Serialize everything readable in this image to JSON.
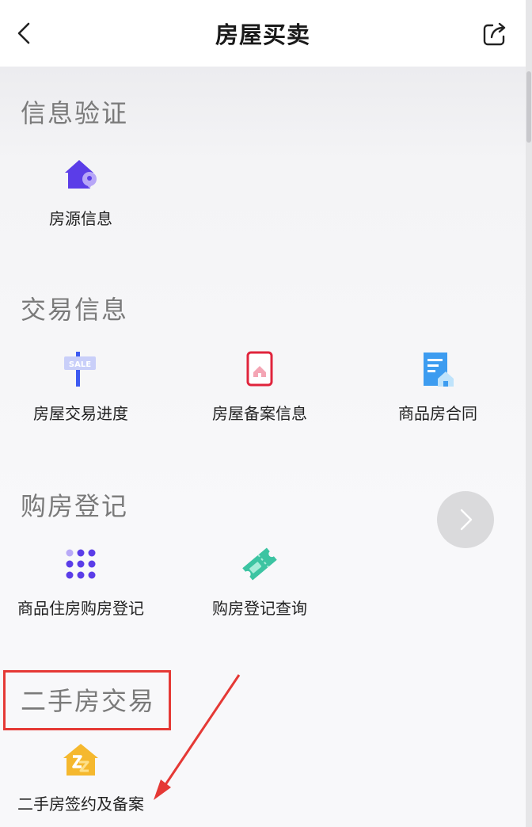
{
  "header": {
    "title": "房屋买卖"
  },
  "sections": [
    {
      "title": "信息验证",
      "items": [
        {
          "label": "房源信息",
          "icon": "house-location-icon"
        }
      ]
    },
    {
      "title": "交易信息",
      "items": [
        {
          "label": "房屋交易进度",
          "icon": "sale-sign-icon"
        },
        {
          "label": "房屋备案信息",
          "icon": "filing-house-icon"
        },
        {
          "label": "商品房合同",
          "icon": "contract-document-icon"
        }
      ]
    },
    {
      "title": "购房登记",
      "items": [
        {
          "label": "商品住房购房登记",
          "icon": "dot-grid-icon"
        },
        {
          "label": "购房登记查询",
          "icon": "ticket-icon"
        }
      ]
    },
    {
      "title": "二手房交易",
      "items": [
        {
          "label": "二手房签约及备案",
          "icon": "second-hand-house-icon"
        }
      ]
    }
  ],
  "colors": {
    "accent_purple": "#5b3de8",
    "highlight_red": "#e53935",
    "ticket_green": "#3cc4a2",
    "doc_blue": "#3d9cf0",
    "house_yellow": "#f5b82e"
  }
}
